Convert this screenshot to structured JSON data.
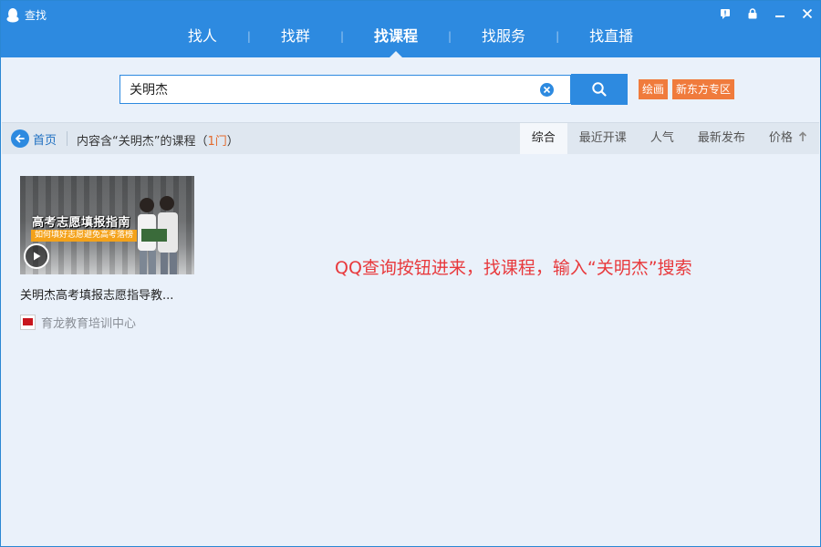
{
  "window": {
    "title": "查找"
  },
  "nav": {
    "items": [
      {
        "label": "找人"
      },
      {
        "label": "找群"
      },
      {
        "label": "找课程"
      },
      {
        "label": "找服务"
      },
      {
        "label": "找直播"
      }
    ],
    "active_index": 2
  },
  "search": {
    "value": "关明杰",
    "tags": [
      "绘画",
      "新东方专区"
    ]
  },
  "filterbar": {
    "home_label": "首页",
    "result_prefix": "内容含“关明杰”的课程（",
    "result_count": "1门",
    "result_suffix": "）",
    "sort_tabs": [
      "综合",
      "最近开课",
      "人气",
      "最新发布",
      "价格"
    ],
    "active_sort": "综合"
  },
  "course": {
    "thumb_title": "高考志愿填报指南",
    "thumb_subtitle": "如何填好志愿避免高考落榜",
    "title": "关明杰高考填报志愿指导教...",
    "provider": "育龙教育培训中心"
  },
  "annotation": "QQ查询按钮进来，找课程，输入“关明杰”搜索",
  "colors": {
    "brand_blue": "#2d8ae0",
    "tag_orange": "#f07b3c",
    "annotation_red": "#e8393c"
  }
}
